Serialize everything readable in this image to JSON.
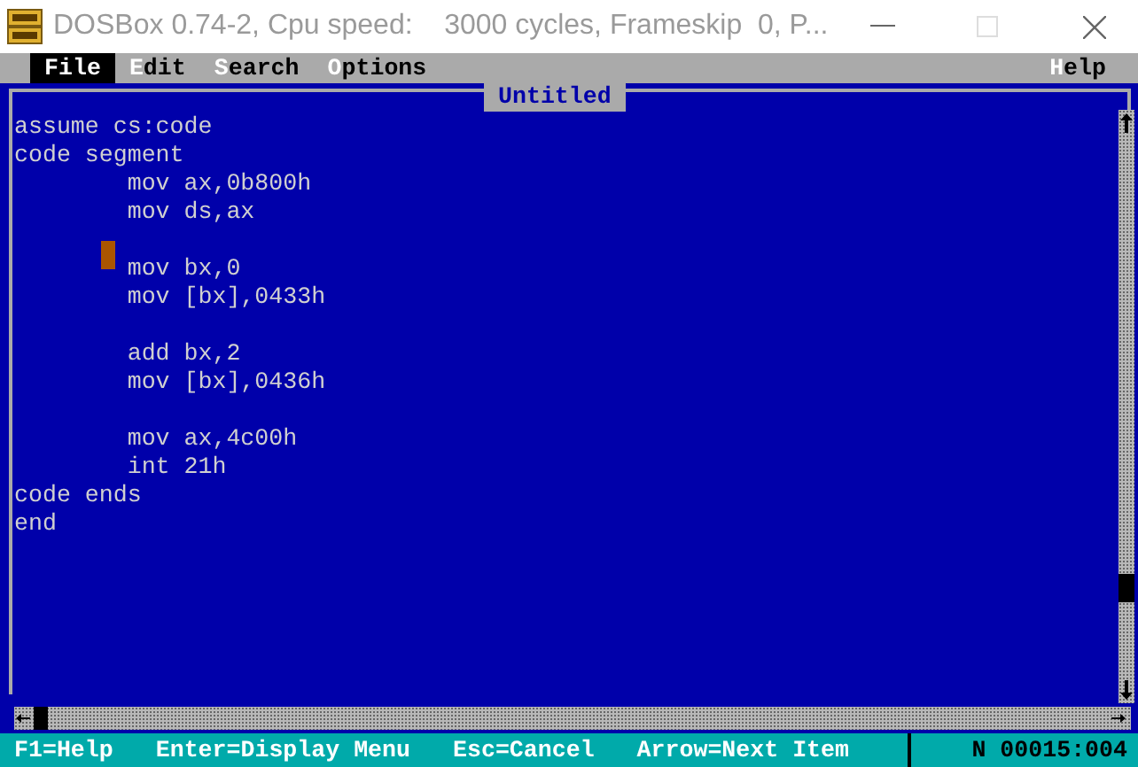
{
  "window": {
    "title": "DOSBox 0.74-2, Cpu speed:    3000 cycles, Frameskip  0, P..."
  },
  "menu": [
    {
      "label": "File",
      "selected": true
    },
    {
      "label": "Edit",
      "selected": false
    },
    {
      "label": "Search",
      "selected": false
    },
    {
      "label": "Options",
      "selected": false
    }
  ],
  "help_menu": {
    "label": "Help",
    "selected": false
  },
  "editor": {
    "title": "Untitled",
    "lines": [
      {
        "text": "assume cs:code",
        "cursor": false
      },
      {
        "text": "code segment",
        "cursor": false
      },
      {
        "text": "        mov ax,0b800h",
        "cursor": false
      },
      {
        "text": "        mov ds,ax",
        "cursor": false
      },
      {
        "cursor": false
      },
      {
        "text": "        mov bx,0",
        "cursor": true
      },
      {
        "text": "        mov [bx],0433h",
        "cursor": false
      },
      {
        "cursor": false
      },
      {
        "text": "        add bx,2",
        "cursor": false
      },
      {
        "text": "        mov [bx],0436h",
        "cursor": false
      },
      {
        "cursor": false
      },
      {
        "text": "        mov ax,4c00h",
        "cursor": false
      },
      {
        "text": "        int 21h",
        "cursor": false
      },
      {
        "text": "code ends",
        "cursor": false
      },
      {
        "text": "end",
        "cursor": false
      }
    ]
  },
  "status_bar": {
    "hints": [
      "F1=Help",
      "Enter=Display Menu",
      "Esc=Cancel",
      "Arrow=Next Item"
    ],
    "position": "N 00015:004"
  }
}
